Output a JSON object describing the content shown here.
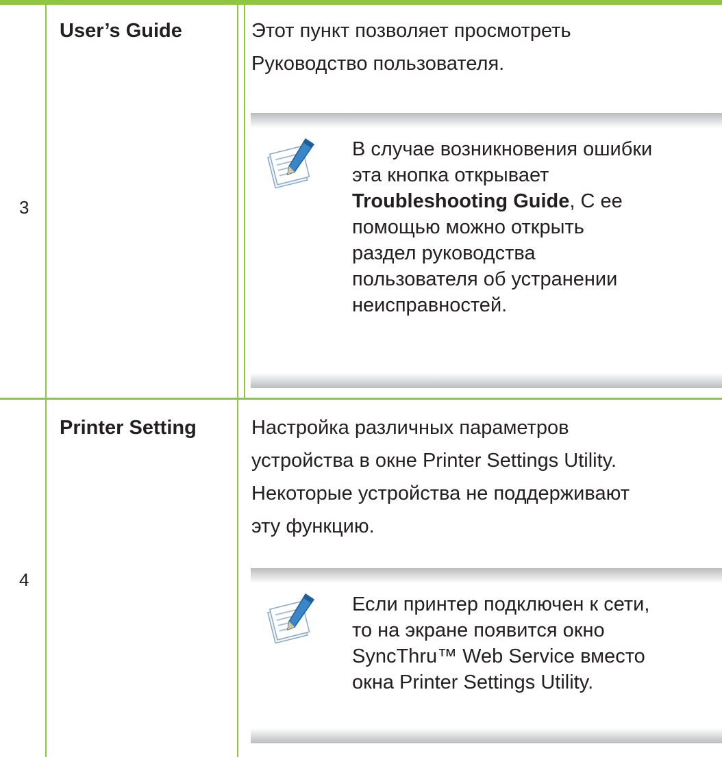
{
  "rows": [
    {
      "number": "3",
      "feature": "User’s Guide",
      "description_lines": [
        "Этот пункт позволяет просмотреть",
        "Руководство пользователя."
      ],
      "note": {
        "icon": "note-pencil-icon",
        "line1": "В случае возникновения ошибки",
        "line2": "эта кнопка открывает",
        "line3_bold": "Troubleshooting Guide",
        "line3_rest": ", С ее",
        "line4": "помощью можно открыть",
        "line5": "раздел руководства",
        "line6": "пользователя об устранении",
        "line7": "неисправностей."
      }
    },
    {
      "number": "4",
      "feature": "Printer Setting",
      "description_lines": [
        "Настройка различных параметров",
        "устройства в окне Printer Settings Utility.",
        "Некоторые устройства не поддерживают",
        "эту функцию."
      ],
      "note": {
        "icon": "note-pencil-icon",
        "line1": "Если принтер подключен к сети,",
        "line2": "то на экране появится окно",
        "line3": "SyncThru™ Web Service вместо",
        "line4": "окна Printer Settings Utility."
      }
    }
  ],
  "colors": {
    "rule_green": "#8dc63f",
    "text": "#231f20",
    "note_bar_gray": "#b9bbbd"
  }
}
